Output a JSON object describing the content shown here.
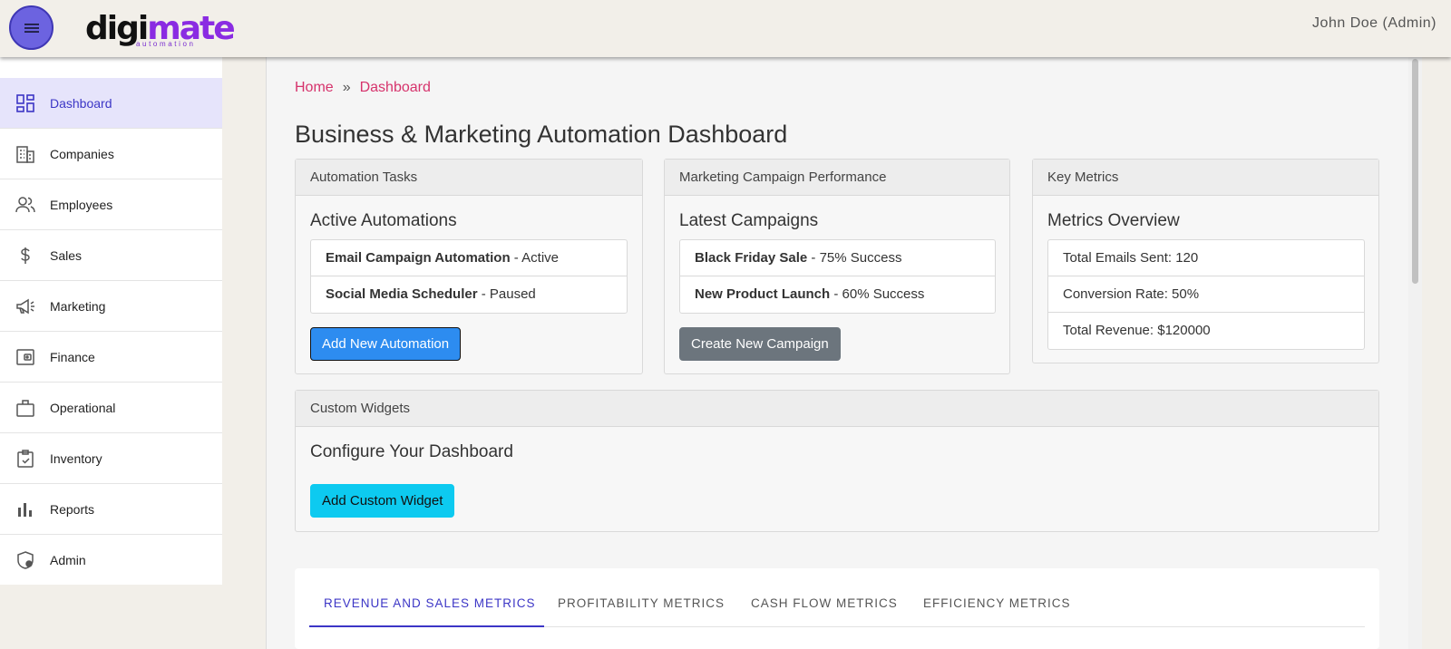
{
  "header": {
    "logo_main_dark": "digi",
    "logo_main_accent": "mate",
    "logo_sub": "automation",
    "user": "John Doe (Admin)"
  },
  "sidebar": {
    "items": [
      {
        "label": "Dashboard",
        "icon": "dashboard-icon",
        "active": true
      },
      {
        "label": "Companies",
        "icon": "building-icon"
      },
      {
        "label": "Employees",
        "icon": "people-icon"
      },
      {
        "label": "Sales",
        "icon": "dollar-icon"
      },
      {
        "label": "Marketing",
        "icon": "megaphone-icon"
      },
      {
        "label": "Finance",
        "icon": "wallet-icon"
      },
      {
        "label": "Operational",
        "icon": "briefcase-icon"
      },
      {
        "label": "Inventory",
        "icon": "clipboard-check-icon"
      },
      {
        "label": "Reports",
        "icon": "bar-chart-icon"
      },
      {
        "label": "Admin",
        "icon": "shield-user-icon"
      }
    ]
  },
  "breadcrumb": {
    "home": "Home",
    "separator": "»",
    "current": "Dashboard"
  },
  "page_title": "Business & Marketing Automation Dashboard",
  "automation": {
    "header": "Automation Tasks",
    "title": "Active Automations",
    "items": [
      {
        "name": "Email Campaign Automation",
        "status": " - Active"
      },
      {
        "name": "Social Media Scheduler",
        "status": " - Paused"
      }
    ],
    "button": "Add New Automation"
  },
  "campaigns": {
    "header": "Marketing Campaign Performance",
    "title": "Latest Campaigns",
    "items": [
      {
        "name": "Black Friday Sale",
        "status": " - 75% Success"
      },
      {
        "name": "New Product Launch",
        "status": " - 60% Success"
      }
    ],
    "button": "Create New Campaign"
  },
  "metrics": {
    "header": "Key Metrics",
    "title": "Metrics Overview",
    "items": [
      "Total Emails Sent: 120",
      "Conversion Rate: 50%",
      "Total Revenue: $120000"
    ]
  },
  "widgets": {
    "header": "Custom Widgets",
    "title": "Configure Your Dashboard",
    "button": "Add Custom Widget"
  },
  "tabs": [
    "REVENUE AND SALES METRICS",
    "PROFITABILITY METRICS",
    "CASH FLOW METRICS",
    "EFFICIENCY METRICS"
  ],
  "colors": {
    "accent": "#3c36c6",
    "breadcrumb": "#d6336c",
    "primary_button": "#2d8cf0",
    "info_button": "#0dcaf0"
  }
}
